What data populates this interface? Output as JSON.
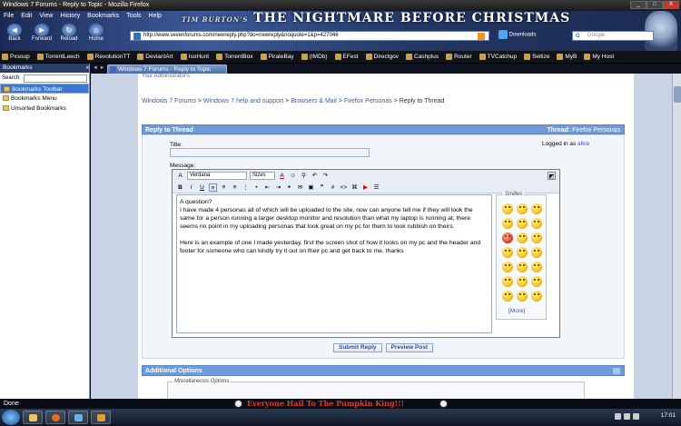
{
  "window": {
    "title": "Windows 7 Forums - Reply to Topic - Mozilla Firefox",
    "controls": [
      "_",
      "□",
      "X"
    ]
  },
  "menu": [
    "File",
    "Edit",
    "View",
    "History",
    "Bookmarks",
    "Tools",
    "Help"
  ],
  "persona": {
    "logo_prefix": "TIM BURTON'S",
    "logo_main": "THE NIGHTMARE BEFORE CHRISTMAS"
  },
  "nav": {
    "back": "Back",
    "forward": "Forward",
    "reload": "Reload",
    "home": "Home"
  },
  "url": "http://www.sevenforums.com/newreply.php?do=newreply&noquote=1&p=427046",
  "downloads": "Downloads",
  "search": {
    "engine": "G",
    "placeholder": "Google"
  },
  "bookmarks": [
    "Pxsoup",
    "TorrentLeech",
    "RevolutionTT",
    "DeviantArt",
    "IsoHunt",
    "TorrentBox",
    "PirateBay",
    "(IMDb)",
    "EFest",
    "Directgov",
    "Cashplus",
    "Router",
    "TVCatchup",
    "Sellize",
    "MyB",
    "My Host"
  ],
  "sidebar": {
    "title": "Bookmarks",
    "close": "x",
    "search_label": "Search:",
    "items": [
      "Bookmarks Toolbar",
      "Bookmarks Menu",
      "Unsorted Bookmarks"
    ]
  },
  "tab": {
    "label": "Windows 7 Forums - Reply to Topic",
    "arrows": "◄ ►"
  },
  "page": {
    "top_text": "Your Administrator's",
    "breadcrumb": [
      "Windows 7 Forums",
      "Windows 7 help and support",
      "Browsers & Mail",
      "Firefox Personas",
      "Reply to Thread"
    ],
    "reply_header": "Reply to Thread",
    "thread_label": "Thread:",
    "thread_name": "Firefox Personas",
    "title_label": "Title:",
    "logged_in_prefix": "Logged in as",
    "logged_in_user": "alkie",
    "message_label": "Message:",
    "font": "Verdana",
    "size": "Sizes",
    "message_lines": [
      "A question?",
      "I have made 4 personas all of which will be uploaded to the site, now can anyone tell me if they will look the same for a person running a larger desktop monitor and resolution than what my laptop is running at, there seems no point in my uploading personas that look great on my pc for them to look rubbish on theirs.",
      "Here is an example of one I made yesterday, first the screen shot of how it looks on my pc and the header and footer for someone who can kindly try it out on their pc and get back to me, thanks"
    ],
    "smilies_label": "Smilies",
    "more": "[More]",
    "submit": "Submit Reply",
    "preview": "Preview Post",
    "additional_options": "Additional Options",
    "misc_options": "Miscellaneous Options"
  },
  "status": {
    "text": "Done",
    "banner": "Everyone Hail To The Pumpkin King!!!"
  },
  "taskbar": {
    "clock": "17:01"
  }
}
